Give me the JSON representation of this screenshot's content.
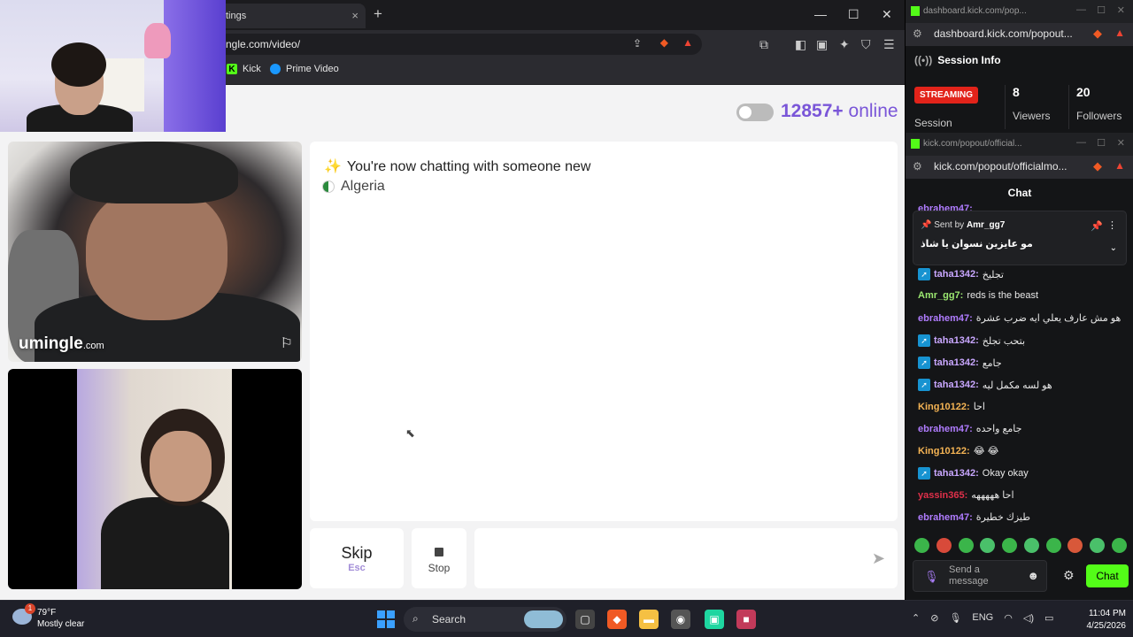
{
  "browser": {
    "tab_title": "tings",
    "new_tab_symbol": "+",
    "url": "ngle.com/video/",
    "bookmarks": [
      {
        "label": "Kick",
        "icon": "kick-icon"
      },
      {
        "label": "Prime Video",
        "icon": "prime-video-icon"
      }
    ]
  },
  "page": {
    "online_count": "12857+",
    "online_label": "online",
    "logo_text": "umingle",
    "logo_domain": ".com",
    "chat_status": "You're now chatting with someone new",
    "country": "Algeria",
    "skip_label": "Skip",
    "skip_shortcut": "Esc",
    "stop_label": "Stop"
  },
  "session_window": {
    "title": "dashboard.kick.com/pop...",
    "url": "dashboard.kick.com/popout...",
    "header": "Session Info",
    "status": "STREAMING",
    "session_label": "Session",
    "stats": [
      {
        "value": "8",
        "label": "Viewers"
      },
      {
        "value": "20",
        "label": "Followers"
      }
    ]
  },
  "chat_window": {
    "title": "kick.com/popout/official...",
    "url": "kick.com/popout/officialmo...",
    "header": "Chat",
    "pinned": {
      "sent_by_prefix": "Sent by",
      "sent_by_user": "Amr_gg7",
      "text": "مو عايزين نسوان يا شاذ"
    },
    "partial_top_user": "ebrahem47:",
    "messages": [
      {
        "user": "taha1342:",
        "color": "#c9a7ff",
        "badge": true,
        "text": "تجليخ"
      },
      {
        "user": "Amr_gg7:",
        "color": "#9be870",
        "badge": false,
        "text": "reds is the beast"
      },
      {
        "user": "ebrahem47:",
        "color": "#b07cff",
        "badge": false,
        "text": "هو مش عارف يعلي ايه ضرب عشرة"
      },
      {
        "user": "taha1342:",
        "color": "#c9a7ff",
        "badge": true,
        "text": "بتحب تجلخ"
      },
      {
        "user": "taha1342:",
        "color": "#c9a7ff",
        "badge": true,
        "text": "جامع"
      },
      {
        "user": "taha1342:",
        "color": "#c9a7ff",
        "badge": true,
        "text": "هو لسه مكمل ليه"
      },
      {
        "user": "King10122:",
        "color": "#f5b454",
        "badge": false,
        "text": "احا"
      },
      {
        "user": "ebrahem47:",
        "color": "#b07cff",
        "badge": false,
        "text": "جامع واحده"
      },
      {
        "user": "King10122:",
        "color": "#f5b454",
        "badge": false,
        "text": "😂 😂"
      },
      {
        "user": "taha1342:",
        "color": "#c9a7ff",
        "badge": true,
        "text": "Okay okay"
      },
      {
        "user": "yassin365:",
        "color": "#e0304a",
        "badge": false,
        "text": "احا هههههه"
      },
      {
        "user": "ebrahem47:",
        "color": "#b07cff",
        "badge": false,
        "text": "طيزك خطيرة"
      }
    ],
    "send_placeholder": "Send a message",
    "chat_button": "Chat"
  },
  "taskbar": {
    "temperature": "79°F",
    "weather": "Mostly clear",
    "notification_count": "1",
    "search_label": "Search",
    "language": "ENG",
    "time": "11:04 PM",
    "date": "4/25/2026"
  },
  "colors": {
    "accent_purple": "#7a56d8",
    "kick_green": "#53fc18",
    "streaming_red": "#e2231a"
  }
}
